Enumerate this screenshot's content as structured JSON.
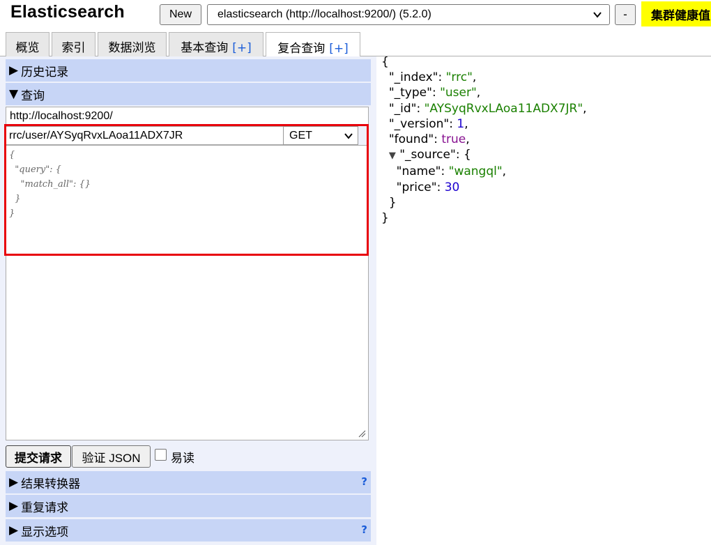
{
  "header": {
    "app_title": "Elasticsearch",
    "new_button": "New",
    "cluster_url": "elasticsearch (http://localhost:9200/) (5.2.0)",
    "minus_button": "-",
    "cluster_health": "集群健康值"
  },
  "tabs": [
    {
      "label": "概览",
      "plus": ""
    },
    {
      "label": "索引",
      "plus": ""
    },
    {
      "label": "数据浏览",
      "plus": ""
    },
    {
      "label": "基本查询",
      "plus": "[+]"
    },
    {
      "label": "复合查询",
      "plus": "[+]"
    }
  ],
  "left_panel": {
    "history_header": "历史记录",
    "query_header": "查询",
    "server_url": "http://localhost:9200/",
    "request_path": "rrc/user/AYSyqRvxLAoa11ADX7JR",
    "method": "GET",
    "request_body": "{\n  \"query\": {\n    \"match_all\": {}\n  }\n}",
    "submit_button": "提交请求",
    "validate_button": "验证 JSON",
    "pretty_label": "易读",
    "result_transformer_header": "结果转换器",
    "repeat_request_header": "重复请求",
    "display_options_header": "显示选项",
    "help_mark": "?"
  },
  "response": {
    "open_brace": "{",
    "close_brace": "}",
    "index_key": "\"_index\"",
    "index_val": "\"rrc\"",
    "type_key": "\"_type\"",
    "type_val": "\"user\"",
    "id_key": "\"_id\"",
    "id_val": "\"AYSyqRvxLAoa11ADX7JR\"",
    "version_key": "\"_version\"",
    "version_val": "1",
    "found_key": "\"found\"",
    "found_val": "true",
    "source_key": "\"_source\"",
    "name_key": "\"name\"",
    "name_val": "\"wangql\"",
    "price_key": "\"price\"",
    "price_val": "30"
  },
  "colors": {
    "section_header_bg": "#c7d5f6",
    "panel_bg": "#eef1fb",
    "health_badge": "#ffff00",
    "highlight_border": "#e8000b",
    "string_green": "#1a8000",
    "number_blue": "#1c00cf",
    "bool_purple": "#881391"
  }
}
